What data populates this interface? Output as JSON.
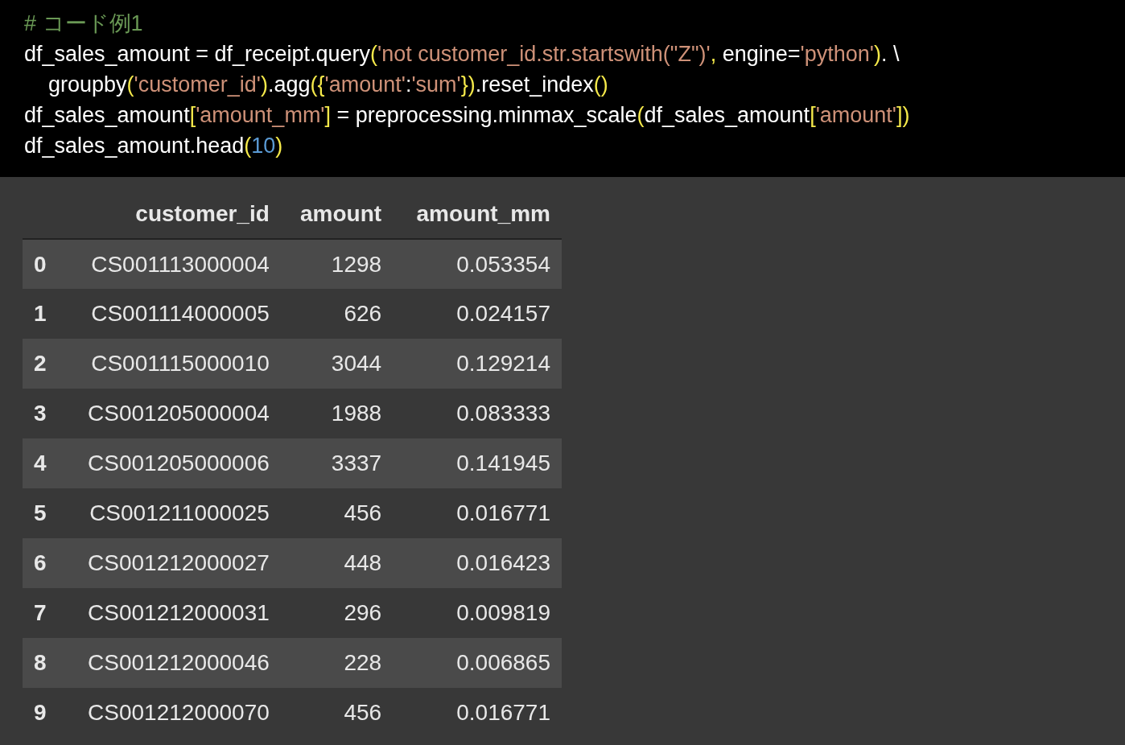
{
  "code_cell": {
    "lines": [
      [
        {
          "kind": "comment",
          "text": "# コード例1"
        }
      ],
      [
        {
          "kind": "plain",
          "text": "df_sales_amount = df_receipt.query"
        },
        {
          "kind": "bracket",
          "text": "("
        },
        {
          "kind": "string",
          "text": "'not customer_id.str.startswith(\"Z\")'"
        },
        {
          "kind": "bracket",
          "text": ", "
        },
        {
          "kind": "plain",
          "text": "engine="
        },
        {
          "kind": "string",
          "text": "'python'"
        },
        {
          "kind": "bracket",
          "text": ")"
        },
        {
          "kind": "plain",
          "text": ". \\"
        }
      ],
      [
        {
          "kind": "plain",
          "text": "    groupby"
        },
        {
          "kind": "bracket",
          "text": "("
        },
        {
          "kind": "string",
          "text": "'customer_id'"
        },
        {
          "kind": "bracket",
          "text": ")"
        },
        {
          "kind": "plain",
          "text": ".agg"
        },
        {
          "kind": "bracket",
          "text": "({"
        },
        {
          "kind": "string",
          "text": "'amount'"
        },
        {
          "kind": "plain",
          "text": ":"
        },
        {
          "kind": "string",
          "text": "'sum'"
        },
        {
          "kind": "bracket",
          "text": "})"
        },
        {
          "kind": "plain",
          "text": ".reset_index"
        },
        {
          "kind": "bracket",
          "text": "()"
        }
      ],
      [
        {
          "kind": "plain",
          "text": "df_sales_amount"
        },
        {
          "kind": "bracket",
          "text": "["
        },
        {
          "kind": "string",
          "text": "'amount_mm'"
        },
        {
          "kind": "bracket",
          "text": "]"
        },
        {
          "kind": "plain",
          "text": " = preprocessing.minmax_scale"
        },
        {
          "kind": "bracket",
          "text": "("
        },
        {
          "kind": "plain",
          "text": "df_sales_amount"
        },
        {
          "kind": "bracket",
          "text": "["
        },
        {
          "kind": "string",
          "text": "'amount'"
        },
        {
          "kind": "bracket",
          "text": "])"
        }
      ],
      [
        {
          "kind": "plain",
          "text": "df_sales_amount.head"
        },
        {
          "kind": "bracket",
          "text": "("
        },
        {
          "kind": "number",
          "text": "10"
        },
        {
          "kind": "bracket",
          "text": ")"
        }
      ]
    ]
  },
  "table": {
    "columns": [
      "customer_id",
      "amount",
      "amount_mm"
    ],
    "rows": [
      {
        "index": "0",
        "cells": [
          "CS001113000004",
          "1298",
          "0.053354"
        ]
      },
      {
        "index": "1",
        "cells": [
          "CS001114000005",
          "626",
          "0.024157"
        ]
      },
      {
        "index": "2",
        "cells": [
          "CS001115000010",
          "3044",
          "0.129214"
        ]
      },
      {
        "index": "3",
        "cells": [
          "CS001205000004",
          "1988",
          "0.083333"
        ]
      },
      {
        "index": "4",
        "cells": [
          "CS001205000006",
          "3337",
          "0.141945"
        ]
      },
      {
        "index": "5",
        "cells": [
          "CS001211000025",
          "456",
          "0.016771"
        ]
      },
      {
        "index": "6",
        "cells": [
          "CS001212000027",
          "448",
          "0.016423"
        ]
      },
      {
        "index": "7",
        "cells": [
          "CS001212000031",
          "296",
          "0.009819"
        ]
      },
      {
        "index": "8",
        "cells": [
          "CS001212000046",
          "228",
          "0.006865"
        ]
      },
      {
        "index": "9",
        "cells": [
          "CS001212000070",
          "456",
          "0.016771"
        ]
      }
    ]
  }
}
